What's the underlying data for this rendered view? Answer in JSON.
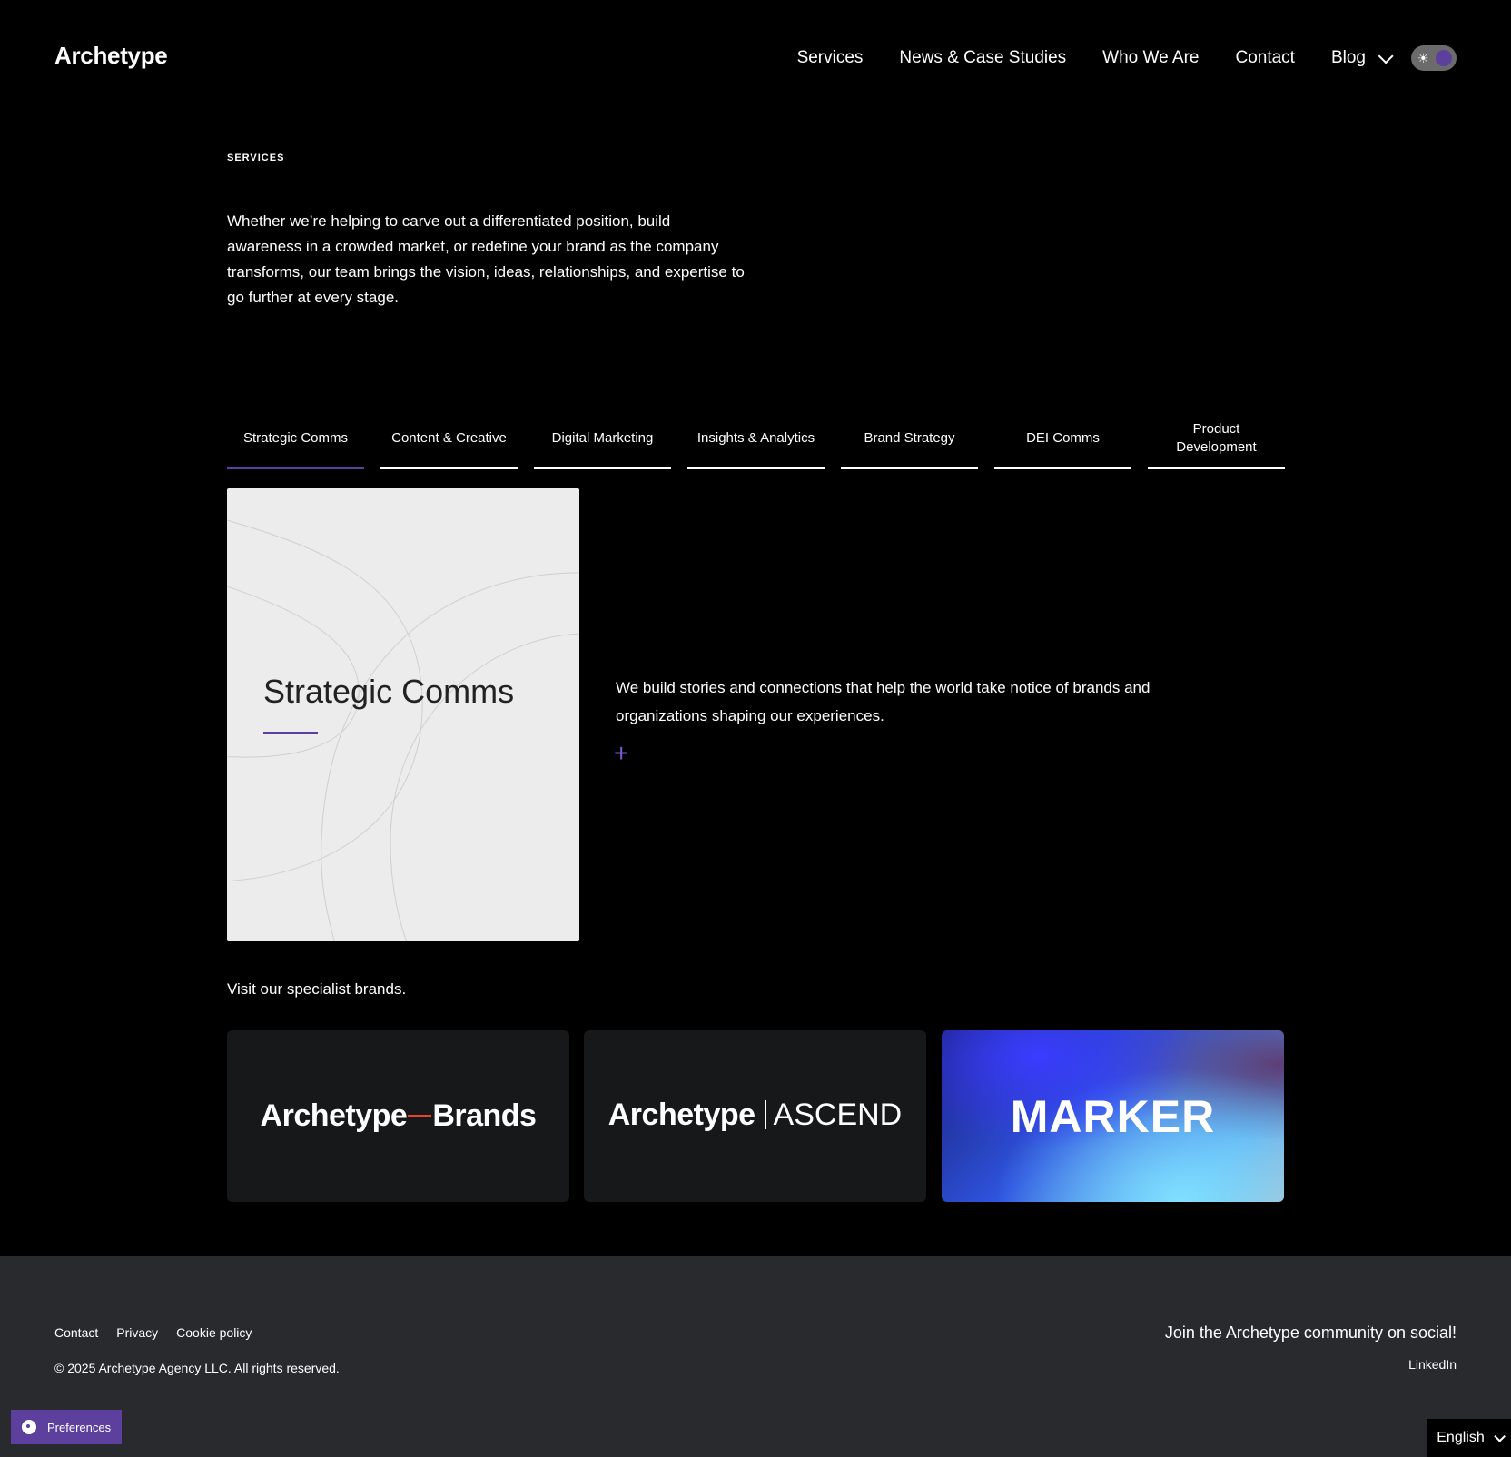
{
  "header": {
    "logo": "Archetype",
    "nav": [
      "Services",
      "News & Case Studies",
      "Who We Are",
      "Contact",
      "Blog"
    ],
    "theme_toggle": "dark"
  },
  "intro": {
    "eyebrow": "SERVICES",
    "text": "Whether we’re helping to carve out a differentiated position, build awareness in a crowded market, or redefine your brand as the company transforms, our team brings the vision, ideas, relationships, and expertise to go further at every stage."
  },
  "tabs": [
    {
      "label": "Strategic Comms",
      "active": true
    },
    {
      "label": "Content & Creative",
      "active": false
    },
    {
      "label": "Digital Marketing",
      "active": false
    },
    {
      "label": "Insights & Analytics",
      "active": false
    },
    {
      "label": "Brand Strategy",
      "active": false
    },
    {
      "label": "DEI Comms",
      "active": false
    },
    {
      "label": "Product Development",
      "active": false
    }
  ],
  "panel": {
    "title": "Strategic Comms",
    "description": "We build stories and connections that help the world take notice of brands and organizations shaping our experiences.",
    "expand_icon": "+"
  },
  "brands": {
    "label": "Visit our specialist brands.",
    "items": [
      {
        "part1": "Archetype",
        "part2": "Brands"
      },
      {
        "part1": "Archetype",
        "part2": "ASCEND"
      },
      {
        "part1": "MARKER"
      }
    ]
  },
  "footer": {
    "links": [
      "Contact",
      "Privacy",
      "Cookie policy"
    ],
    "copyright": "© 2025 Archetype Agency LLC. All rights reserved.",
    "social_heading": "Join the Archetype community on social!",
    "social_link": "LinkedIn",
    "preferences": "Preferences",
    "language": "English"
  },
  "colors": {
    "accent": "#5d3f9e",
    "background": "#000000",
    "footer_bg": "#292a2e",
    "card_bg": "#ececec"
  }
}
